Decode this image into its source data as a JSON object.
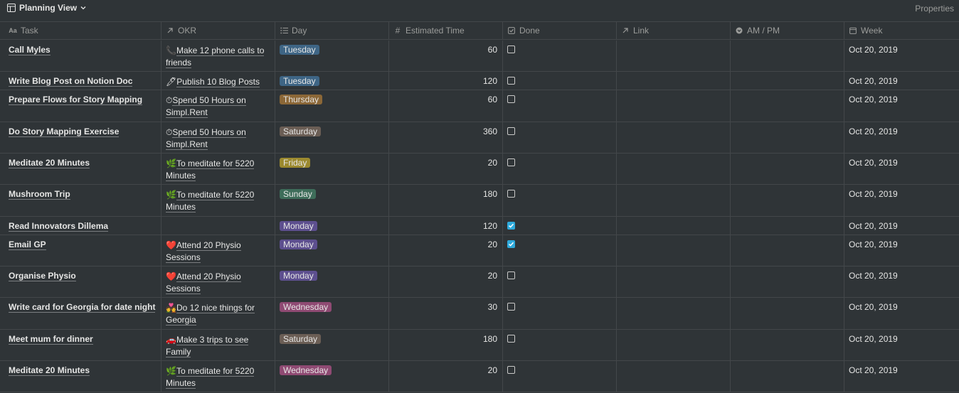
{
  "view": {
    "title": "Planning View",
    "properties_label": "Properties"
  },
  "columns": [
    {
      "label": "Task",
      "icon": "text-icon"
    },
    {
      "label": "OKR",
      "icon": "relation-arrow-icon"
    },
    {
      "label": "Day",
      "icon": "list-icon"
    },
    {
      "label": "Estimated Time",
      "icon": "number-icon"
    },
    {
      "label": "Done",
      "icon": "checkbox-icon"
    },
    {
      "label": "Link",
      "icon": "relation-arrow-icon"
    },
    {
      "label": "AM / PM",
      "icon": "select-icon"
    },
    {
      "label": "Week",
      "icon": "calendar-icon"
    }
  ],
  "colors": {
    "Tuesday": "#3e6585",
    "Thursday": "#8b6737",
    "Saturday": "#6b5e55",
    "Friday": "#9c8a2f",
    "Sunday": "#3e6d5a",
    "Monday": "#5d4f8f",
    "Wednesday": "#8f4a73"
  },
  "rows": [
    {
      "task": "Call Myles",
      "okr_emoji": "📞",
      "okr": "Make 12 phone calls to friends",
      "day": "Tuesday",
      "est": "60",
      "done": false,
      "week": "Oct 20, 2019"
    },
    {
      "task": "Write Blog Post on Notion Doc",
      "okr_emoji": "🖊",
      "okr": "Publish 10 Blog Posts",
      "day": "Tuesday",
      "est": "120",
      "done": false,
      "week": "Oct 20, 2019"
    },
    {
      "task": "Prepare Flows for Story Mapping",
      "okr_emoji": "⏱",
      "okr": "Spend 50 Hours on Simpl.Rent",
      "day": "Thursday",
      "est": "60",
      "done": false,
      "week": "Oct 20, 2019"
    },
    {
      "task": "Do Story Mapping Exercise",
      "okr_emoji": "⏱",
      "okr": "Spend 50 Hours on Simpl.Rent",
      "day": "Saturday",
      "est": "360",
      "done": false,
      "week": "Oct 20, 2019"
    },
    {
      "task": "Meditate 20 Minutes",
      "okr_emoji": "🌿",
      "okr": "To meditate for 5220 Minutes",
      "day": "Friday",
      "est": "20",
      "done": false,
      "week": "Oct 20, 2019"
    },
    {
      "task": "Mushroom Trip",
      "okr_emoji": "🌿",
      "okr": "To meditate for 5220 Minutes",
      "day": "Sunday",
      "est": "180",
      "done": false,
      "week": "Oct 20, 2019"
    },
    {
      "task": "Read Innovators Dillema",
      "okr_emoji": "",
      "okr": "",
      "day": "Monday",
      "est": "120",
      "done": true,
      "week": "Oct 20, 2019"
    },
    {
      "task": "Email GP",
      "okr_emoji": "❤️",
      "okr": "Attend 20 Physio Sessions",
      "day": "Monday",
      "est": "20",
      "done": true,
      "week": "Oct 20, 2019"
    },
    {
      "task": "Organise Physio",
      "okr_emoji": "❤️",
      "okr": "Attend 20 Physio Sessions",
      "day": "Monday",
      "est": "20",
      "done": false,
      "week": "Oct 20, 2019"
    },
    {
      "task": "Write card for Georgia for date night",
      "okr_emoji": "💑",
      "okr": "Do 12 nice things for Georgia",
      "day": "Wednesday",
      "est": "30",
      "done": false,
      "week": "Oct 20, 2019"
    },
    {
      "task": "Meet mum for dinner",
      "okr_emoji": "🚗",
      "okr": "Make 3 trips to see Family",
      "day": "Saturday",
      "est": "180",
      "done": false,
      "week": "Oct 20, 2019"
    },
    {
      "task": "Meditate 20 Minutes",
      "okr_emoji": "🌿",
      "okr": "To meditate for 5220 Minutes",
      "day": "Wednesday",
      "est": "20",
      "done": false,
      "week": "Oct 20, 2019"
    }
  ]
}
